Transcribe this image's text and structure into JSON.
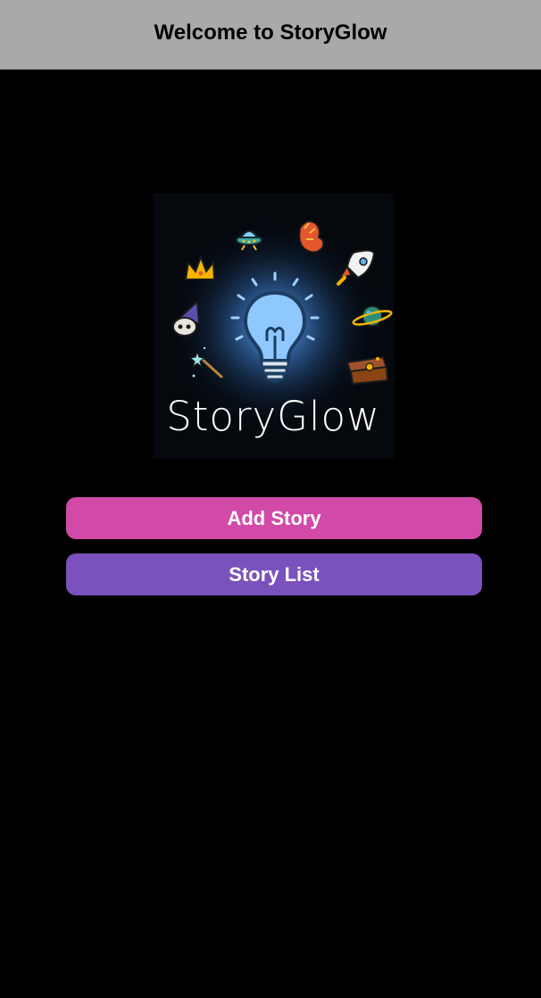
{
  "header": {
    "title": "Welcome to StoryGlow"
  },
  "logo": {
    "brand_text": "StoryGlow",
    "central_icon": "lightbulb-icon",
    "surrounding_icons": [
      "ufo-icon",
      "dragon-icon",
      "crown-icon",
      "rocket-icon",
      "wizard-skull-icon",
      "planet-icon",
      "magic-wand-icon",
      "treasure-chest-icon"
    ]
  },
  "actions": {
    "add_story_label": "Add Story",
    "story_list_label": "Story List"
  },
  "colors": {
    "header_bg": "#a9a9a9",
    "page_bg": "#000000",
    "add_story_bg": "#d14aa8",
    "story_list_bg": "#7b52bd",
    "glow": "#4a90d9"
  }
}
